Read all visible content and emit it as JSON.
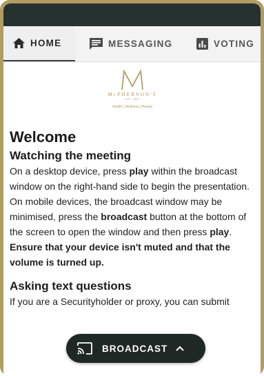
{
  "tabs": [
    {
      "label": "HOME",
      "icon": "home-icon",
      "active": true
    },
    {
      "label": "MESSAGING",
      "icon": "chat-icon",
      "active": false
    },
    {
      "label": "VOTING",
      "icon": "bar-chart-icon",
      "active": false
    }
  ],
  "logo": {
    "letter": "M",
    "name": "McPHERSON'S",
    "est": "EST. 1860",
    "tagline": "Health | Wellness | Beauty"
  },
  "content": {
    "title": "Welcome",
    "watching_heading": "Watching the meeting",
    "watching_parts": {
      "t1": "On a desktop device, press ",
      "b1": "play",
      "t2": " within the broadcast window on the right-hand side to begin the presentation. On mobile devices, the broadcast window may be minimised, press the ",
      "b2": "broadcast",
      "t3": " button at the bottom of the screen to open the window and then press ",
      "b3": "play",
      "t4": ". ",
      "b4": "Ensure that your device isn't muted and that the volume is turned up."
    },
    "asking_heading": "Asking text questions",
    "asking_text": "If you are a Securityholder or proxy, you can submit"
  },
  "broadcast_button": {
    "label": "BROADCAST",
    "icon": "cast-icon",
    "chevron": "chevron-up-icon"
  },
  "colors": {
    "frame": "#b29c63",
    "topbar": "#26322f",
    "tabs_bg": "#f3f3f3",
    "broadcast_bg": "#1f2825",
    "gold": "#b29c63"
  }
}
